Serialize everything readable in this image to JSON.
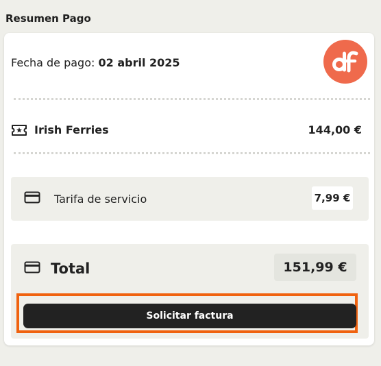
{
  "section_title": "Resumen Pago",
  "payment": {
    "date_label": "Fecha de pago:",
    "date_value": "02 abril 2025"
  },
  "logo": {
    "text": "df",
    "color": "#ef6a4c"
  },
  "line_item": {
    "icon": "ticket-icon",
    "name": "Irish Ferries",
    "price": "144,00 €"
  },
  "fee": {
    "icon": "credit-card-icon",
    "label": "Tarifa de servicio",
    "price": "7,99 €"
  },
  "total": {
    "icon": "credit-card-icon",
    "label": "Total",
    "price": "151,99 €"
  },
  "actions": {
    "invoice_button": "Solicitar factura",
    "highlight_color": "#f0620f"
  }
}
